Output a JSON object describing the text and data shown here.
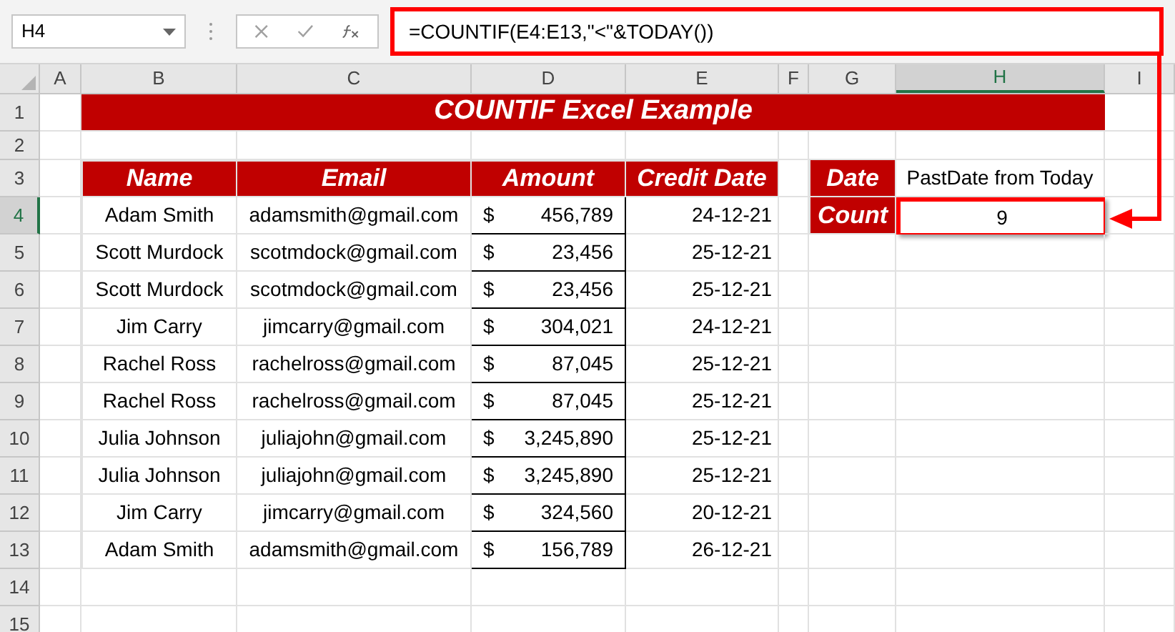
{
  "name_box": "H4",
  "formula": {
    "text": "=COUNTIF(E4:E13,\"<\"&TODAY())",
    "highlighted": true
  },
  "columns": [
    {
      "label": "A",
      "selected": false
    },
    {
      "label": "B",
      "selected": false
    },
    {
      "label": "C",
      "selected": false
    },
    {
      "label": "D",
      "selected": false
    },
    {
      "label": "E",
      "selected": false
    },
    {
      "label": "F",
      "selected": false
    },
    {
      "label": "G",
      "selected": false
    },
    {
      "label": "H",
      "selected": true
    },
    {
      "label": "I",
      "selected": false
    }
  ],
  "rows": [
    {
      "label": "1",
      "selected": false
    },
    {
      "label": "2",
      "selected": false
    },
    {
      "label": "3",
      "selected": false
    },
    {
      "label": "4",
      "selected": true
    },
    {
      "label": "5",
      "selected": false
    },
    {
      "label": "6",
      "selected": false
    },
    {
      "label": "7",
      "selected": false
    },
    {
      "label": "8",
      "selected": false
    },
    {
      "label": "9",
      "selected": false
    },
    {
      "label": "10",
      "selected": false
    },
    {
      "label": "11",
      "selected": false
    },
    {
      "label": "12",
      "selected": false
    },
    {
      "label": "13",
      "selected": false
    },
    {
      "label": "14",
      "selected": false
    },
    {
      "label": "15",
      "selected": false
    }
  ],
  "title": "COUNTIF Excel Example",
  "table": {
    "columns": [
      "Name",
      "Email",
      "Amount",
      "Credit Date"
    ],
    "rows": [
      {
        "name": "Adam Smith",
        "email": "adamsmith@gmail.com",
        "currency": "$",
        "amount": "456,789",
        "date": "24-12-21"
      },
      {
        "name": "Scott Murdock",
        "email": "scotmdock@gmail.com",
        "currency": "$",
        "amount": "23,456",
        "date": "25-12-21"
      },
      {
        "name": "Scott Murdock",
        "email": "scotmdock@gmail.com",
        "currency": "$",
        "amount": "23,456",
        "date": "25-12-21"
      },
      {
        "name": "Jim Carry",
        "email": "jimcarry@gmail.com",
        "currency": "$",
        "amount": "304,021",
        "date": "24-12-21"
      },
      {
        "name": "Rachel Ross",
        "email": "rachelross@gmail.com",
        "currency": "$",
        "amount": "87,045",
        "date": "25-12-21"
      },
      {
        "name": "Rachel Ross",
        "email": "rachelross@gmail.com",
        "currency": "$",
        "amount": "87,045",
        "date": "25-12-21"
      },
      {
        "name": "Julia Johnson",
        "email": "juliajohn@gmail.com",
        "currency": "$",
        "amount": "3,245,890",
        "date": "25-12-21"
      },
      {
        "name": "Julia Johnson",
        "email": "juliajohn@gmail.com",
        "currency": "$",
        "amount": "3,245,890",
        "date": "25-12-21"
      },
      {
        "name": "Jim Carry",
        "email": "jimcarry@gmail.com",
        "currency": "$",
        "amount": "324,560",
        "date": "20-12-21"
      },
      {
        "name": "Adam Smith",
        "email": "adamsmith@gmail.com",
        "currency": "$",
        "amount": "156,789",
        "date": "26-12-21"
      }
    ]
  },
  "summary": [
    {
      "label": "Date",
      "value": "PastDate from Today",
      "highlighted": false
    },
    {
      "label": "Count",
      "value": "9",
      "highlighted": true
    }
  ]
}
